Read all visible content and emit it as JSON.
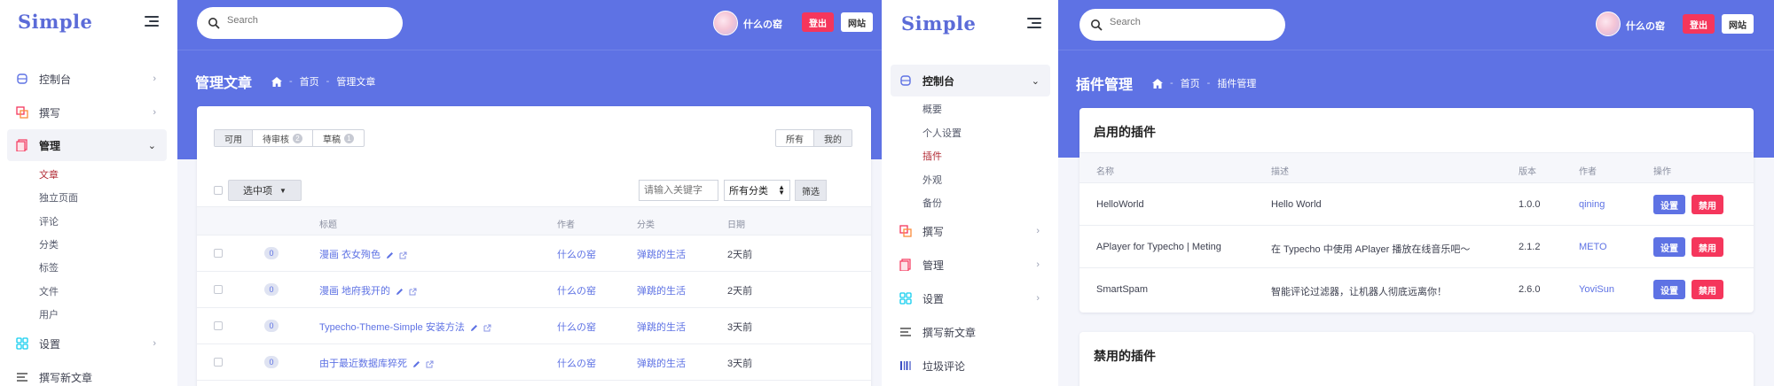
{
  "colors": {
    "primary": "#5e72e4",
    "danger": "#f5365c",
    "active_sub": "#b22c36"
  },
  "left": {
    "sidebar": {
      "logo": "Simple",
      "items": [
        {
          "label": "控制台",
          "icon": "dashboard-icon"
        },
        {
          "label": "撰写",
          "icon": "write-icon"
        },
        {
          "label": "管理",
          "icon": "manage-icon"
        },
        {
          "label": "设置",
          "icon": "settings-icon"
        },
        {
          "label": "撰写新文章",
          "icon": "new-post-icon"
        }
      ],
      "manage_sub": [
        "文章",
        "独立页面",
        "评论",
        "分类",
        "标签",
        "文件",
        "用户"
      ]
    },
    "header": {
      "search_placeholder": "Search",
      "username": "什么の窑",
      "logout": "登出",
      "site": "网站"
    },
    "page_title": "管理文章",
    "breadcrumb": [
      "首页",
      "管理文章"
    ],
    "filters": {
      "status": [
        {
          "label": "可用"
        },
        {
          "label": "待审核",
          "count": "2"
        },
        {
          "label": "草稿",
          "count": "1"
        }
      ],
      "scope": [
        "所有",
        "我的"
      ],
      "select_label": "选中项",
      "keyword_placeholder": "请输入关键字",
      "category": "所有分类",
      "filter_btn": "筛选"
    },
    "table": {
      "headers": [
        "标题",
        "作者",
        "分类",
        "日期"
      ],
      "rows": [
        {
          "count": "0",
          "title": "漫画 衣女殉色",
          "author": "什么の窑",
          "category": "弹跳的生活",
          "date": "2天前"
        },
        {
          "count": "0",
          "title": "漫画 地府我开的",
          "author": "什么の窑",
          "category": "弹跳的生活",
          "date": "2天前"
        },
        {
          "count": "0",
          "title": "Typecho-Theme-Simple 安装方法",
          "author": "什么の窑",
          "category": "弹跳的生活",
          "date": "3天前"
        },
        {
          "count": "0",
          "title": "由于最近数据库猝死",
          "author": "什么の窑",
          "category": "弹跳的生活",
          "date": "3天前"
        }
      ]
    }
  },
  "right": {
    "sidebar": {
      "logo": "Simple",
      "items": [
        {
          "label": "控制台",
          "icon": "dashboard-icon"
        },
        {
          "label": "撰写",
          "icon": "write-icon"
        },
        {
          "label": "管理",
          "icon": "manage-icon"
        },
        {
          "label": "设置",
          "icon": "settings-icon"
        },
        {
          "label": "撰写新文章",
          "icon": "new-post-icon"
        },
        {
          "label": "垃圾评论",
          "icon": "spam-icon"
        }
      ],
      "dashboard_sub": [
        "概要",
        "个人设置",
        "插件",
        "外观",
        "备份"
      ]
    },
    "header": {
      "search_placeholder": "Search",
      "username": "什么の窑",
      "logout": "登出",
      "site": "网站"
    },
    "page_title": "插件管理",
    "breadcrumb": [
      "首页",
      "插件管理"
    ],
    "enabled": {
      "title": "启用的插件",
      "headers": [
        "名称",
        "描述",
        "版本",
        "作者",
        "操作"
      ],
      "rows": [
        {
          "name": "HelloWorld",
          "desc": "Hello World",
          "version": "1.0.0",
          "author": "qining"
        },
        {
          "name": "APlayer for Typecho | Meting",
          "desc": "在 Typecho 中使用 APlayer 播放在线音乐吧～",
          "version": "2.1.2",
          "author": "METO"
        },
        {
          "name": "SmartSpam",
          "desc": "智能评论过滤器，让机器人彻底远离你！",
          "version": "2.6.0",
          "author": "YoviSun"
        }
      ],
      "btn_set": "设置",
      "btn_disable": "禁用"
    },
    "disabled": {
      "title": "禁用的插件"
    }
  }
}
